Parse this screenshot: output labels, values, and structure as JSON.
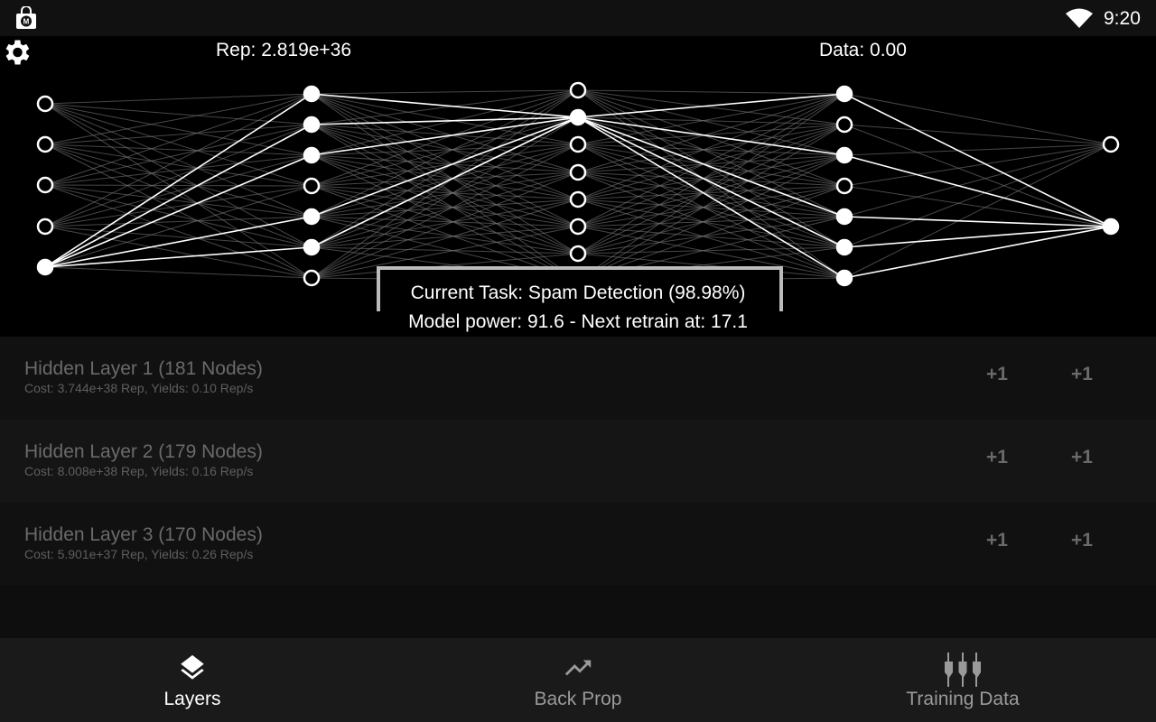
{
  "status_bar": {
    "time": "9:20",
    "app_icon": "shopping-bag-icon",
    "wifi_icon": "wifi-icon"
  },
  "header": {
    "rep": "Rep: 2.819e+36",
    "data": "Data: 0.00",
    "settings_icon": "gear-icon"
  },
  "network": {
    "layers": [
      [
        0,
        0,
        0,
        0,
        1
      ],
      [
        1,
        1,
        1,
        0,
        1,
        1,
        0
      ],
      [
        0,
        1,
        0,
        0,
        0,
        0,
        0,
        0
      ],
      [
        1,
        0,
        1,
        0,
        1,
        1,
        1
      ],
      [
        0,
        1
      ]
    ],
    "colors": {
      "active": "#ffffff",
      "edge": "#777777",
      "active_edge": "#ffffff"
    }
  },
  "task": {
    "current": "Current Task: Spam Detection (98.98%)",
    "power": "Model power: 91.6 - Next retrain at: 17.1"
  },
  "layers": [
    {
      "title": "Hidden Layer 1 (181 Nodes)",
      "sub": "Cost: 3.744e+38 Rep, Yields: 0.10 Rep/s",
      "btn1": "+1",
      "btn2": "+1"
    },
    {
      "title": "Hidden Layer 2 (179 Nodes)",
      "sub": "Cost: 8.008e+38 Rep, Yields: 0.16 Rep/s",
      "btn1": "+1",
      "btn2": "+1"
    },
    {
      "title": "Hidden Layer 3 (170 Nodes)",
      "sub": "Cost: 5.901e+37 Rep, Yields: 0.26 Rep/s",
      "btn1": "+1",
      "btn2": "+1"
    }
  ],
  "nav": [
    {
      "label": "Layers",
      "icon": "layers-icon",
      "active": true
    },
    {
      "label": "Back Prop",
      "icon": "trending-up-icon",
      "active": false
    },
    {
      "label": "Training Data",
      "icon": "equalizer-icon",
      "active": false
    }
  ]
}
